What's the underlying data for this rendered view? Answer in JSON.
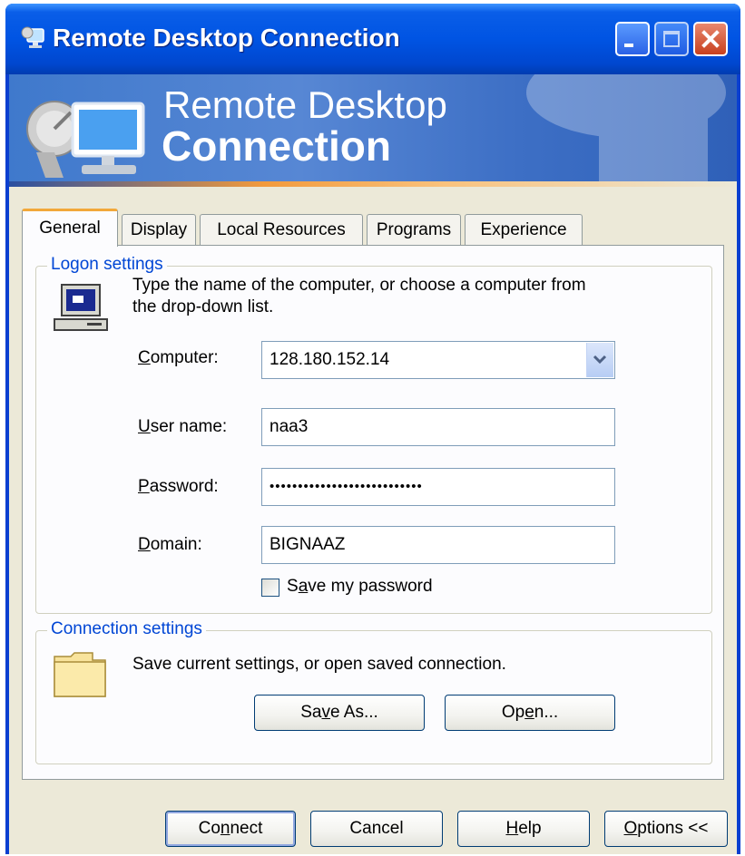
{
  "window": {
    "title": "Remote Desktop Connection"
  },
  "banner": {
    "line1": "Remote Desktop",
    "line2": "Connection"
  },
  "tabs": [
    {
      "label": "General",
      "active": true
    },
    {
      "label": "Display",
      "active": false
    },
    {
      "label": "Local Resources",
      "active": false
    },
    {
      "label": "Programs",
      "active": false
    },
    {
      "label": "Experience",
      "active": false
    }
  ],
  "logon": {
    "group_label": "Logon settings",
    "instruction_line1": "Type the name of the computer, or choose a computer from",
    "instruction_line2": "the drop-down list.",
    "computer": {
      "label_u": "C",
      "label_rest": "omputer:",
      "value": "128.180.152.14"
    },
    "user_name": {
      "label_u": "U",
      "label_rest": "ser name:",
      "value": "naa3"
    },
    "password": {
      "label_u": "P",
      "label_rest": "assword:",
      "value": "•••••••••••••••••••••••••••"
    },
    "domain": {
      "label_u": "D",
      "label_rest": "omain:",
      "value": "BIGNAAZ"
    },
    "save_password": {
      "label_pre": "S",
      "label_u": "a",
      "label_rest": "ve my password",
      "checked": false
    }
  },
  "connection": {
    "group_label": "Connection settings",
    "description": "Save current settings, or open saved connection.",
    "save_as": {
      "pre": "Sa",
      "u": "v",
      "rest": "e As..."
    },
    "open": {
      "pre": "Op",
      "u": "e",
      "rest": "n..."
    }
  },
  "buttons": {
    "connect": {
      "pre": "Co",
      "u": "n",
      "rest": "nect"
    },
    "cancel": "Cancel",
    "help": {
      "u": "H",
      "rest": "elp"
    },
    "options": {
      "u": "O",
      "rest": "ptions <<"
    }
  },
  "colors": {
    "titlebar": "#0054e3",
    "group_label": "#0046d5",
    "face": "#ece9d8",
    "tab_highlight": "#f2a83a"
  }
}
